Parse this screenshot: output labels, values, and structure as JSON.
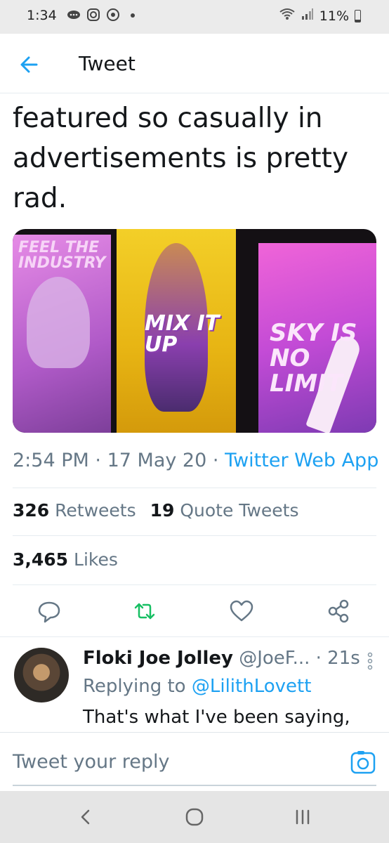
{
  "status_bar": {
    "time": "1:34",
    "battery": "11%",
    "battery_level": 0.11
  },
  "header": {
    "title": "Tweet"
  },
  "tweet": {
    "text_lines": [
      "featured so casually in",
      "advertisements is pretty",
      "rad."
    ],
    "image_alt_texts": [
      "FEEL THE INDUSTRY",
      "MIX IT UP",
      "SKY IS NO LIMIT"
    ],
    "time": "2:54 PM",
    "date": "17 May 20",
    "separator": "·",
    "source": "Twitter Web App",
    "retweets_count": "326",
    "retweets_label": "Retweets",
    "quote_count": "19",
    "quote_label": "Quote Tweets",
    "likes_count": "3,465",
    "likes_label": "Likes"
  },
  "reply": {
    "name": "Floki Joe Jolley",
    "handle": "@JoeF...",
    "time": "· 21s",
    "replying_prefix": "Replying to",
    "replying_to": "@LilithLovett",
    "text": "That's what I've been saying,"
  },
  "compose": {
    "placeholder": "Tweet your reply"
  },
  "colors": {
    "accent": "#1da1f2",
    "retweet": "#17bf63",
    "muted": "#657786"
  }
}
